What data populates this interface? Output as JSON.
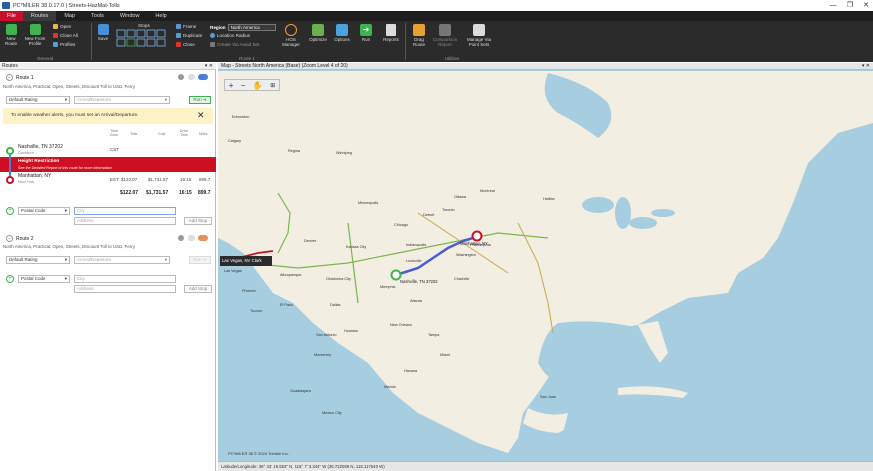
{
  "window": {
    "title": "PC*MILER 38.0.17.0 | Streets-HazMat-Tolls",
    "minimize": "—",
    "restore": "❐",
    "close": "✕"
  },
  "menu": [
    "File",
    "Routes",
    "Map",
    "Tools",
    "Window",
    "Help"
  ],
  "ribbon": {
    "general": {
      "new_route": "New Route",
      "new_from_profile": "New From Profile",
      "open": "Open",
      "close_all": "Close All",
      "profiles": "Profiles",
      "label": "General"
    },
    "route": {
      "save": "Save",
      "stops": "Stops",
      "frame": "Frame",
      "duplicate": "Duplicate",
      "close": "Close",
      "region_label": "Region",
      "region_value": "North America",
      "location_radius": "Location Radius",
      "create_via": "Create Via Avoid Set",
      "hos_manager": "HOS Manager",
      "optimize": "Optimize",
      "options": "Options",
      "run": "Run",
      "reports": "Reports",
      "label": "Route 1"
    },
    "utilities": {
      "drag_route": "Drag Route",
      "comparison_report": "Comparison Report",
      "manage_via": "Manage Via Point Sets",
      "label": "Utilities"
    }
  },
  "routes_panel": {
    "header": "Routes",
    "route1": {
      "title": "Route 1",
      "desc": "North America, Practical, Open, Streets, Discount Toll to USD, Ferry",
      "rating": "Default Rating",
      "arrival_placeholder": "Arrival/Departure",
      "run_label": "Run ➔",
      "weather_msg": "To enable weather alerts, you must set an Arrival/Departure.",
      "columns": [
        "Time Zone",
        "Tolls",
        "Cost",
        "Drive Time",
        "Miles"
      ],
      "stop1": {
        "name": "Nashville, TN 37202",
        "sub": "Davidson",
        "tz": "CST"
      },
      "alert_title": "Height Restriction",
      "alert_sub": "See the Detailed Report of this route for more information",
      "stop2": {
        "name": "Manhattan, NY",
        "sub": "New York",
        "tz": "EST",
        "tolls": "$122.07",
        "cost": "$1,731.57",
        "time": "16:15",
        "miles": "899.7"
      },
      "totals": {
        "tolls": "$122.07",
        "cost": "$1,731.57",
        "time": "16:15",
        "miles": "899.7"
      },
      "postal_label": "Postal Code",
      "city_placeholder": "City",
      "address_placeholder": "Address",
      "add_stop": "Add Stop"
    },
    "route2": {
      "title": "Route 2",
      "desc": "North America, Practical, Open, Streets, Discount Toll to USD, Ferry",
      "rating": "Default Rating",
      "arrival_placeholder": "Arrival/Departure",
      "run_label": "Run ➔",
      "postal_label": "Postal Code",
      "city_placeholder": "City",
      "address_placeholder": "Address",
      "add_stop": "Add Stop"
    }
  },
  "map": {
    "header": "Map - Streets North America (Base) (Zoom Level 4 of 20)",
    "tooltip": "Las Vegas, NV Clark",
    "origin_label": "Nashville, TN 37202",
    "dest_label": "Manhattan, NY",
    "status": "Latitude/Longitude: 36° 43' 19.553\" N, 115° 7' 3.344\" W (36.722098 N, 115.117540 W)",
    "copyright": "PC*MILER 38 © 2024 Trimble Inc.",
    "cities": [
      "Edmonton",
      "Calgary",
      "Regina",
      "Winnipeg",
      "Montreal",
      "Ottawa",
      "Halifax",
      "Chicago",
      "Detroit",
      "Toronto",
      "Minneapolis",
      "Denver",
      "Kansas City",
      "Indianapolis",
      "Louisville",
      "Memphis",
      "Atlanta",
      "Washington",
      "Philadelphia",
      "Houston",
      "Dallas",
      "San Antonio",
      "Phoenix",
      "Tucson",
      "El Paso",
      "Monterrey",
      "Guadalajara",
      "Havana",
      "San Juan",
      "Miami",
      "Tampa",
      "New Orleans",
      "Charlotte",
      "Oklahoma City",
      "Albuquerque",
      "Las Vegas",
      "Mexico City",
      "Merida"
    ]
  }
}
